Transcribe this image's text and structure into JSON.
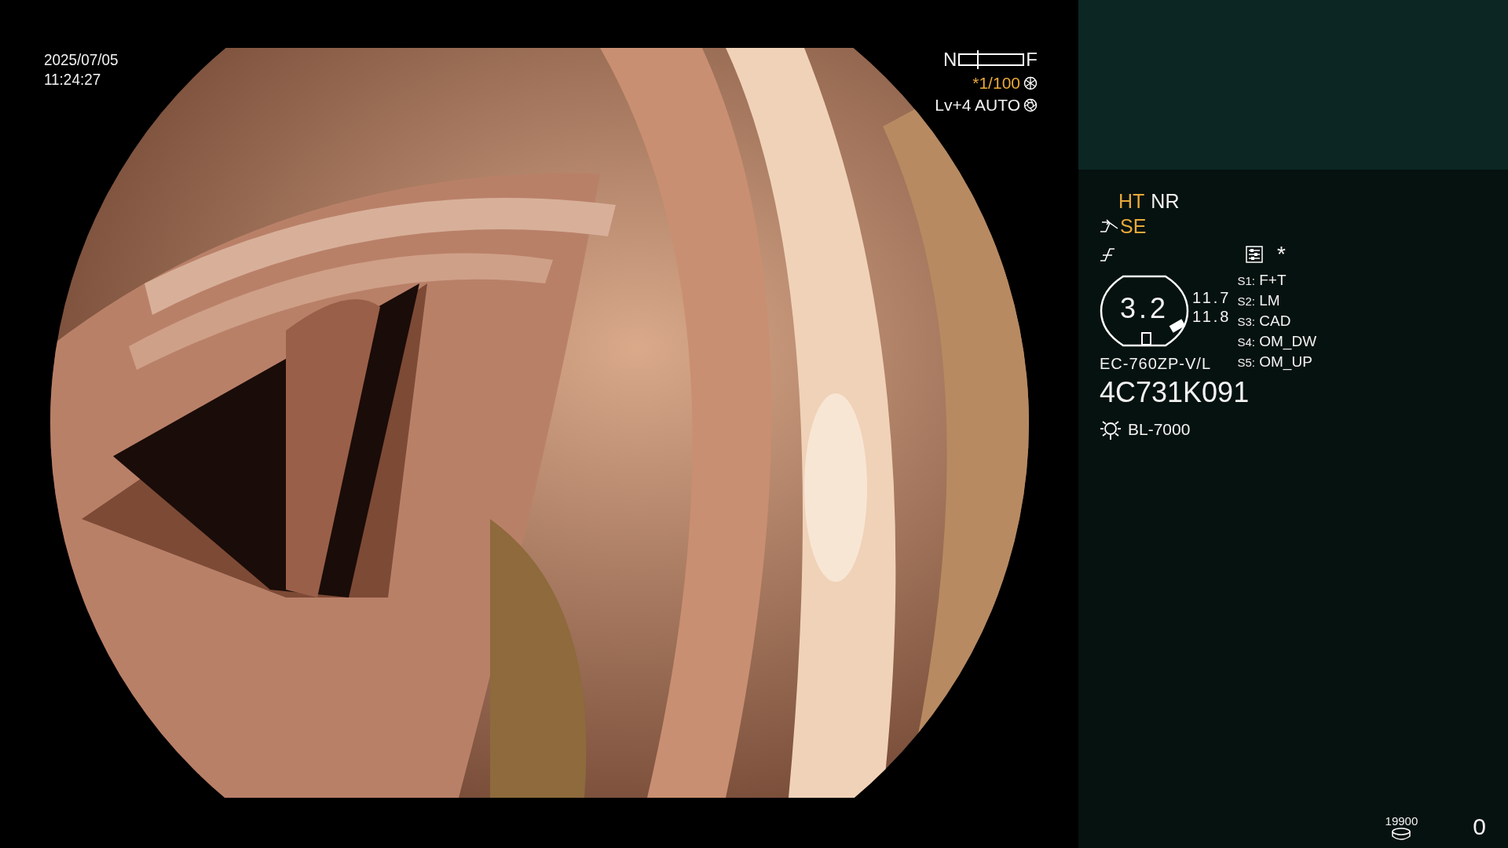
{
  "timestamp": {
    "date": "2025/07/05",
    "time": "11:24:27"
  },
  "focus_scale": {
    "near_label": "N",
    "far_label": "F",
    "level": 0.27
  },
  "shutter": {
    "value": "*1/100"
  },
  "brightness": {
    "value": "Lv+4 AUTO"
  },
  "modes": [
    {
      "label": "HT",
      "active": true
    },
    {
      "label": "NR",
      "active": false
    }
  ],
  "enhancement": {
    "label": "SE",
    "active": true
  },
  "asterisk": "*",
  "scope": {
    "value": "3.2",
    "readings": [
      "11.7",
      "11.8"
    ],
    "model": "EC-760ZP-V/L",
    "serial": "4C731K091"
  },
  "switches": [
    {
      "key": "S1:",
      "value": "F+T"
    },
    {
      "key": "S2:",
      "value": "LM"
    },
    {
      "key": "S3:",
      "value": "CAD"
    },
    {
      "key": "S4:",
      "value": "OM_DW"
    },
    {
      "key": "S5:",
      "value": "OM_UP"
    }
  ],
  "light_source": "BL-7000",
  "storage": {
    "count": "19900"
  },
  "counter": "0"
}
